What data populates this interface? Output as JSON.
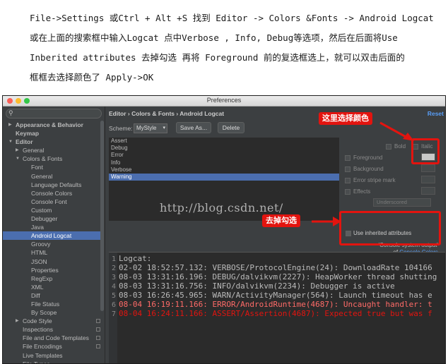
{
  "instructions": [
    "File->Settings 或Ctrl + Alt +S 找到 Editor -> Colors &Fonts -> Android Logcat",
    "或在上面的搜索框中输入Logcat 点中Verbose , Info, Debug等选项，然后在后面将Use",
    "Inberited attributes 去掉勾选 再将 Foreground 前的复选框选上，就可以双击后面的",
    "框框去选择颜色了 Apply->OK"
  ],
  "window": {
    "title": "Preferences"
  },
  "search": {
    "placeholder": "",
    "icon": "search-icon"
  },
  "tree": [
    {
      "label": "Appearance & Behavior",
      "indent": 1,
      "arrow": "▶",
      "bold": true
    },
    {
      "label": "Keymap",
      "indent": 1,
      "arrow": "",
      "bold": true
    },
    {
      "label": "Editor",
      "indent": 1,
      "arrow": "▼",
      "bold": true
    },
    {
      "label": "General",
      "indent": 2,
      "arrow": "▶"
    },
    {
      "label": "Colors & Fonts",
      "indent": 2,
      "arrow": "▼"
    },
    {
      "label": "Font",
      "indent": 3,
      "arrow": ""
    },
    {
      "label": "General",
      "indent": 3,
      "arrow": ""
    },
    {
      "label": "Language Defaults",
      "indent": 3,
      "arrow": ""
    },
    {
      "label": "Console Colors",
      "indent": 3,
      "arrow": ""
    },
    {
      "label": "Console Font",
      "indent": 3,
      "arrow": ""
    },
    {
      "label": "Custom",
      "indent": 3,
      "arrow": ""
    },
    {
      "label": "Debugger",
      "indent": 3,
      "arrow": ""
    },
    {
      "label": "Java",
      "indent": 3,
      "arrow": ""
    },
    {
      "label": "Android Logcat",
      "indent": 3,
      "arrow": "",
      "selected": true
    },
    {
      "label": "Groovy",
      "indent": 3,
      "arrow": ""
    },
    {
      "label": "HTML",
      "indent": 3,
      "arrow": ""
    },
    {
      "label": "JSON",
      "indent": 3,
      "arrow": ""
    },
    {
      "label": "Properties",
      "indent": 3,
      "arrow": ""
    },
    {
      "label": "RegExp",
      "indent": 3,
      "arrow": ""
    },
    {
      "label": "XML",
      "indent": 3,
      "arrow": ""
    },
    {
      "label": "Diff",
      "indent": 3,
      "arrow": ""
    },
    {
      "label": "File Status",
      "indent": 3,
      "arrow": ""
    },
    {
      "label": "By Scope",
      "indent": 3,
      "arrow": ""
    },
    {
      "label": "Code Style",
      "indent": 2,
      "arrow": "▶",
      "copy": true
    },
    {
      "label": "Inspections",
      "indent": 2,
      "arrow": "",
      "copy": true
    },
    {
      "label": "File and Code Templates",
      "indent": 2,
      "arrow": "",
      "copy": true
    },
    {
      "label": "File Encodings",
      "indent": 2,
      "arrow": "",
      "copy": true
    },
    {
      "label": "Live Templates",
      "indent": 2,
      "arrow": ""
    },
    {
      "label": "File Types",
      "indent": 2,
      "arrow": ""
    }
  ],
  "breadcrumb": "Editor › Colors & Fonts › Android Logcat",
  "reset_label": "Reset",
  "scheme": {
    "label": "Scheme:",
    "value": "MyStyle",
    "save_as": "Save As...",
    "delete": "Delete"
  },
  "levels": [
    {
      "label": "Assert"
    },
    {
      "label": "Debug"
    },
    {
      "label": "Error"
    },
    {
      "label": "Info"
    },
    {
      "label": "Verbose"
    },
    {
      "label": "Warning",
      "selected": true
    }
  ],
  "watermark": "http://blog.csdn.net/",
  "options": {
    "bold": "Bold",
    "italic": "Italic",
    "foreground": "Foreground",
    "background": "Background",
    "error_stripe": "Error stripe mark",
    "effects": "Effects",
    "effect_type": "Underscored",
    "foreground_color": "#c8c8c8"
  },
  "inherit": {
    "label": "Use inherited attributes",
    "desc": "'Console system output'",
    "of": "of",
    "link": "Console Colors"
  },
  "preview": [
    {
      "num": "1",
      "text": "Logcat:",
      "color": "#bbbbbb"
    },
    {
      "num": "2",
      "text": "02-02 18:52:57.132: VERBOSE/ProtocolEngine(24): DownloadRate 104166",
      "color": "#bbbbbb"
    },
    {
      "num": "3",
      "text": "08-03 13:31:16.196: DEBUG/dalvikvm(2227): HeapWorker thread shutting",
      "color": "#bbbbbb"
    },
    {
      "num": "4",
      "text": "08-03 13:31:16.756: INFO/dalvikvm(2234): Debugger is active",
      "color": "#bbbbbb"
    },
    {
      "num": "5",
      "text": "08-03 16:26:45.965: WARN/ActivityManager(564): Launch timeout has e",
      "color": "#bbbbbb"
    },
    {
      "num": "6",
      "text": "08-04 16:19:11.166: ERROR/AndroidRuntime(4687): Uncaught handler: t",
      "color": "#ff6b68"
    },
    {
      "num": "7",
      "text": "08-04 16:24:11.166: ASSERT/Assertion(4687): Expected true but was f",
      "color": "#e3140f"
    }
  ],
  "annotations": {
    "choose_color": "这里选择颜色",
    "uncheck": "去掉勾选",
    "color": "#e3140f"
  }
}
